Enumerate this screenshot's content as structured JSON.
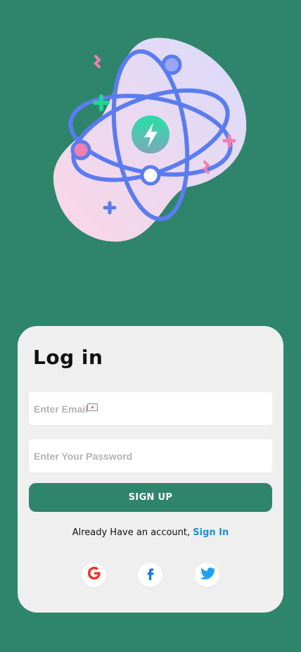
{
  "colors": {
    "background": "#2e856c",
    "card": "#efefef",
    "button": "#2e856c",
    "link": "#1a8fd1"
  },
  "login": {
    "title": "Log in",
    "email_placeholder": "Enter Email",
    "password_placeholder": "Enter Your Password",
    "signup_label": "SIGN UP",
    "account_prompt": "Already Have an account,",
    "signin_label": "Sign In"
  },
  "social": [
    {
      "name": "google-icon"
    },
    {
      "name": "facebook-icon"
    },
    {
      "name": "twitter-icon"
    }
  ]
}
